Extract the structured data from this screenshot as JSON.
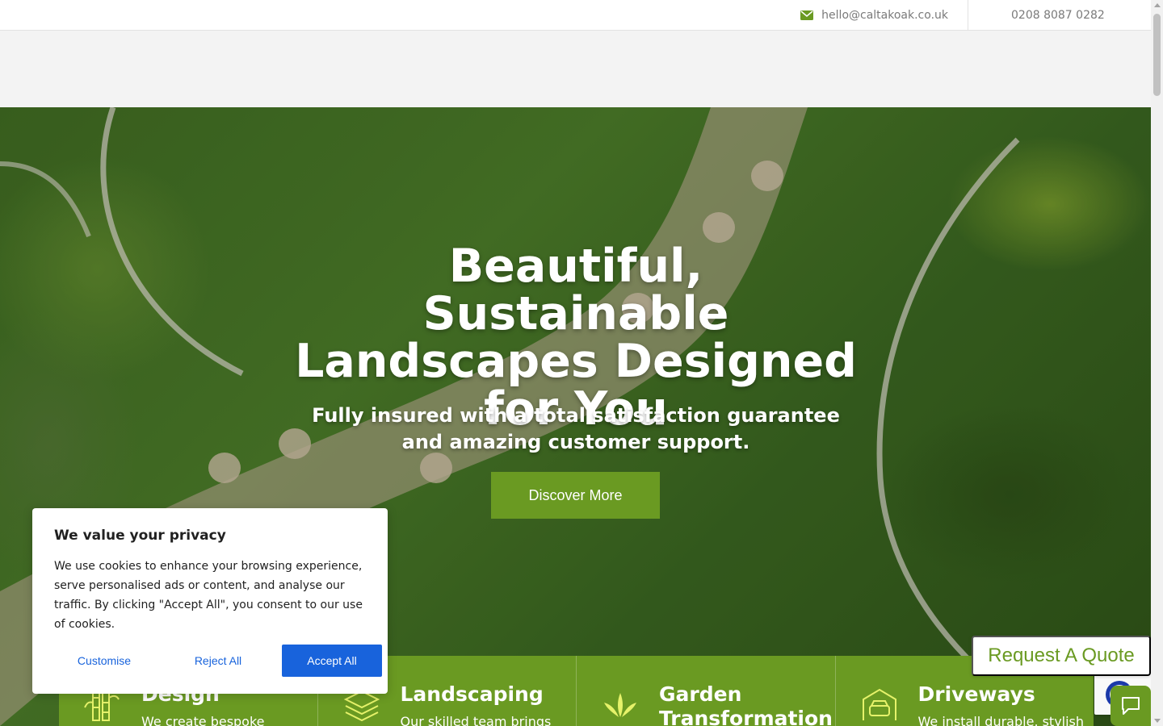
{
  "topbar": {
    "email": "hello@caltakoak.co.uk",
    "phone": "0208 8087 0282"
  },
  "hero": {
    "title": "Beautiful, Sustainable Landscapes Designed for You",
    "subtitle": "Fully insured with a total satisfaction guarantee and amazing customer support.",
    "cta_label": "Discover More"
  },
  "services": [
    {
      "title": "Design",
      "description": "We create bespoke",
      "icon": "bamboo-icon"
    },
    {
      "title": "Landscaping",
      "description": "Our skilled team brings",
      "icon": "layers-icon"
    },
    {
      "title": "Garden Transformation",
      "description": "",
      "icon": "plant-sprout-icon"
    },
    {
      "title": "Driveways",
      "description": "We install durable, stylish",
      "icon": "car-garage-icon"
    }
  ],
  "cookie": {
    "title": "We value your privacy",
    "body": "We use cookies to enhance your browsing experience, serve personalised ads or content, and analyse our traffic. By clicking \"Accept All\", you consent to our use of cookies.",
    "customise_label": "Customise",
    "reject_label": "Reject All",
    "accept_label": "Accept All"
  },
  "quote_label": "Request A Quote",
  "colors": {
    "brand_green": "#6a9a22",
    "cookie_blue": "#1863dc",
    "text_gray": "#7a7a7a"
  }
}
